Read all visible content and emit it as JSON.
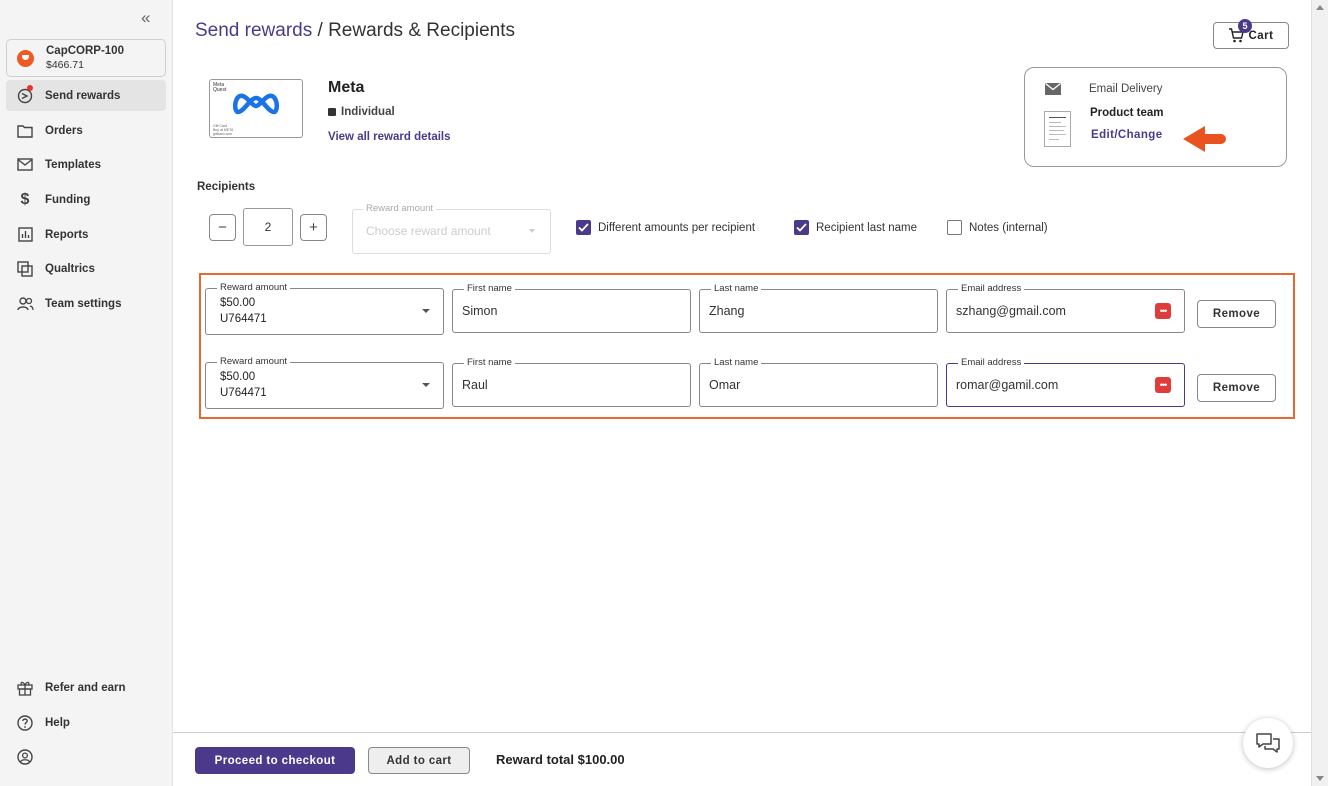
{
  "sidebar": {
    "collapse_glyph": "«",
    "account": {
      "name": "CapCORP-100",
      "balance": "$466.71"
    },
    "items": [
      {
        "label": "Send rewards",
        "icon": "send-icon",
        "active": true
      },
      {
        "label": "Orders",
        "icon": "folder-icon"
      },
      {
        "label": "Templates",
        "icon": "envelope-icon"
      },
      {
        "label": "Funding",
        "icon": "dollar-icon"
      },
      {
        "label": "Reports",
        "icon": "bar-chart-icon"
      },
      {
        "label": "Qualtrics",
        "icon": "qualtrics-icon"
      },
      {
        "label": "Team settings",
        "icon": "team-icon"
      }
    ],
    "bottom_items": [
      {
        "label": "Refer and earn",
        "icon": "gift-icon"
      },
      {
        "label": "Help",
        "icon": "help-icon"
      },
      {
        "label": "",
        "icon": "user-icon"
      }
    ]
  },
  "header": {
    "breadcrumb_link": "Send rewards",
    "breadcrumb_sep": " / ",
    "breadcrumb_current": "Rewards & Recipients",
    "cart_label": "Cart",
    "cart_count": "5"
  },
  "reward": {
    "card_text_top": "Meta Quest",
    "card_text_bottom": "Gift Card\nBuy at META\ngiftcard.com",
    "name": "Meta",
    "type": "Individual",
    "details_link": "View all reward details"
  },
  "delivery": {
    "label": "Email Delivery",
    "template": "Product team",
    "edit_link": "Edit/Change",
    "accent": "#e8531f"
  },
  "recipients": {
    "title": "Recipients",
    "quantity": "2",
    "minus": "−",
    "plus": "+",
    "amount_label": "Reward amount",
    "amount_placeholder": "Choose reward amount",
    "options": [
      {
        "label": "Different amounts per recipient",
        "checked": true
      },
      {
        "label": "Recipient last name",
        "checked": true
      },
      {
        "label": "Notes (internal)",
        "checked": false
      }
    ],
    "field_labels": {
      "amount": "Reward amount",
      "first": "First name",
      "last": "Last name",
      "email": "Email address"
    },
    "rows": [
      {
        "amount": "$50.00",
        "code": "U764471",
        "first": "Simon",
        "last": "Zhang",
        "email": "szhang@gmail.com",
        "remove": "Remove"
      },
      {
        "amount": "$50.00",
        "code": "U764471",
        "first": "Raul",
        "last": "Omar",
        "email": "romar@gamil.com",
        "remove": "Remove"
      }
    ]
  },
  "footer": {
    "checkout": "Proceed to checkout",
    "add_to_cart": "Add to cart",
    "total": "Reward total $100.00"
  },
  "colors": {
    "brand": "#4b3a8c",
    "highlight": "#e56a2e"
  }
}
